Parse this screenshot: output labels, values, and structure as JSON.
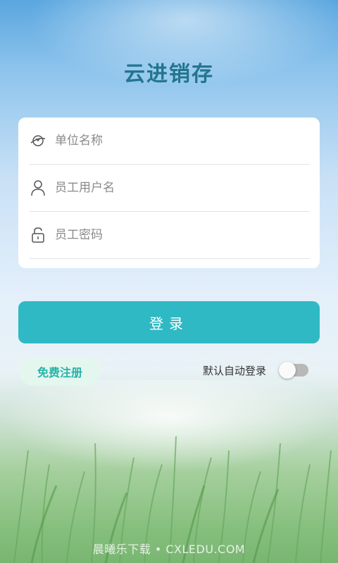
{
  "app": {
    "title": "云进销存"
  },
  "form": {
    "company": {
      "placeholder": "单位名称",
      "value": ""
    },
    "username": {
      "placeholder": "员工用户名",
      "value": ""
    },
    "password": {
      "placeholder": "员工密码",
      "value": ""
    }
  },
  "actions": {
    "login_label": "登录",
    "register_label": "免费注册",
    "auto_login_label": "默认自动登录",
    "auto_login_enabled": false
  },
  "watermark": "晨曦乐下载 • CXLEDU.COM",
  "colors": {
    "title": "#23758f",
    "primary": "#2fb9c4",
    "register_bg": "#e4f7ef",
    "register_text": "#27b3a8"
  },
  "icons": {
    "company": "company-icon",
    "username": "user-icon",
    "password": "lock-icon"
  }
}
